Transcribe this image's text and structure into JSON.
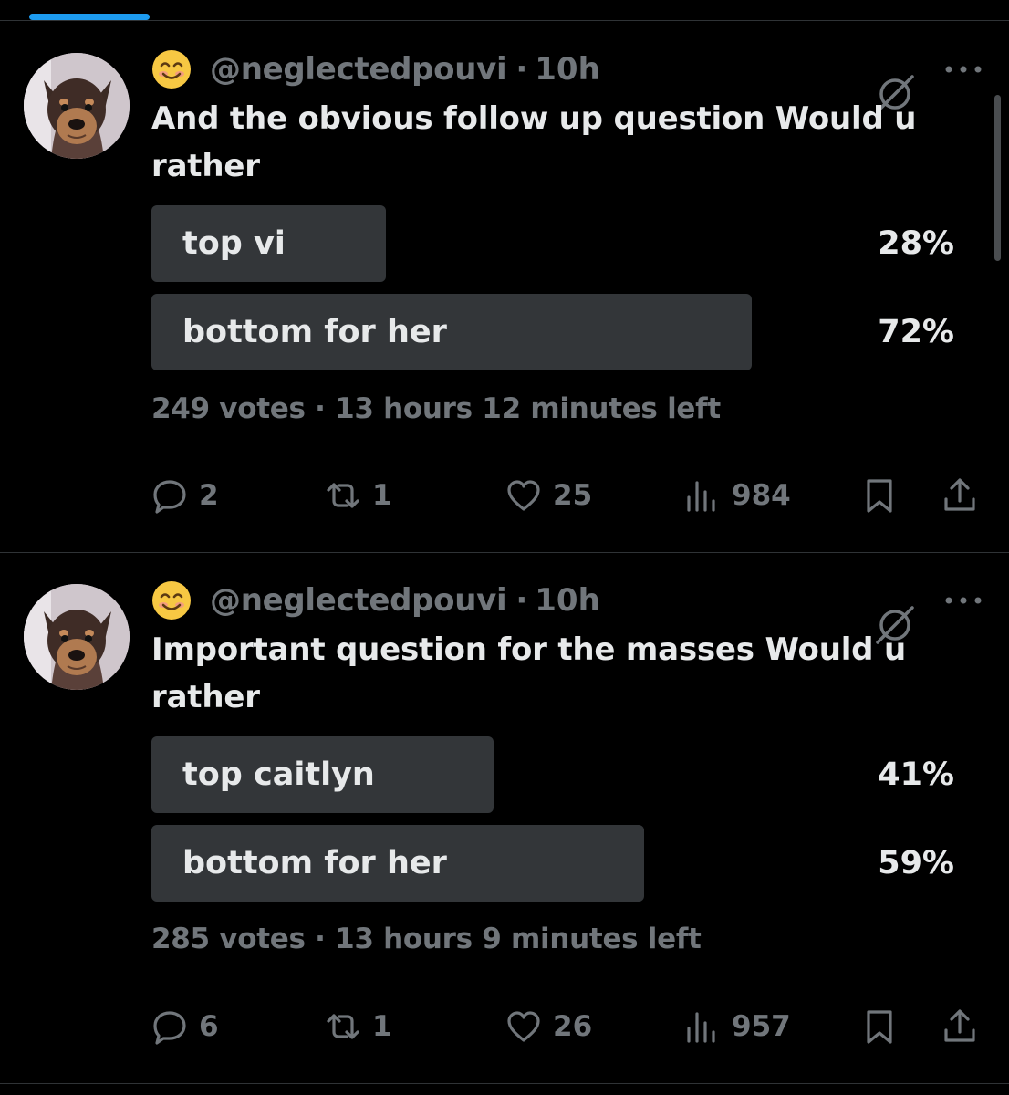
{
  "colors": {
    "background": "#000000",
    "text": "#e7e9ea",
    "muted": "#71767b",
    "poll_bar": "#333639",
    "accent": "#1d9bf0",
    "divider": "#2f3336"
  },
  "icons": [
    "smiling-face-emoji",
    "grok-icon",
    "more-icon",
    "reply-icon",
    "retweet-icon",
    "like-icon",
    "views-icon",
    "bookmark-icon",
    "share-icon"
  ],
  "tweets": [
    {
      "emoji": "😊",
      "handle": "@neglectedpouvi",
      "dot": "·",
      "time": "10h",
      "text": "And the obvious follow up question Would u rather",
      "poll": {
        "options": [
          {
            "label": "top vi",
            "percent": "28%",
            "share": 0.28
          },
          {
            "label": "bottom for her",
            "percent": "72%",
            "share": 0.72
          }
        ],
        "votes": "249 votes",
        "dot": "·",
        "time_left": "13 hours 12 minutes left"
      },
      "actions": {
        "replies": "2",
        "retweets": "1",
        "likes": "25",
        "views": "984"
      }
    },
    {
      "emoji": "😊",
      "handle": "@neglectedpouvi",
      "dot": "·",
      "time": "10h",
      "text": "Important question for the masses Would u rather",
      "poll": {
        "options": [
          {
            "label": "top caitlyn",
            "percent": "41%",
            "share": 0.41
          },
          {
            "label": "bottom for her",
            "percent": "59%",
            "share": 0.59
          }
        ],
        "votes": "285 votes",
        "dot": "·",
        "time_left": "13 hours 9 minutes left"
      },
      "actions": {
        "replies": "6",
        "retweets": "1",
        "likes": "26",
        "views": "957"
      }
    }
  ]
}
